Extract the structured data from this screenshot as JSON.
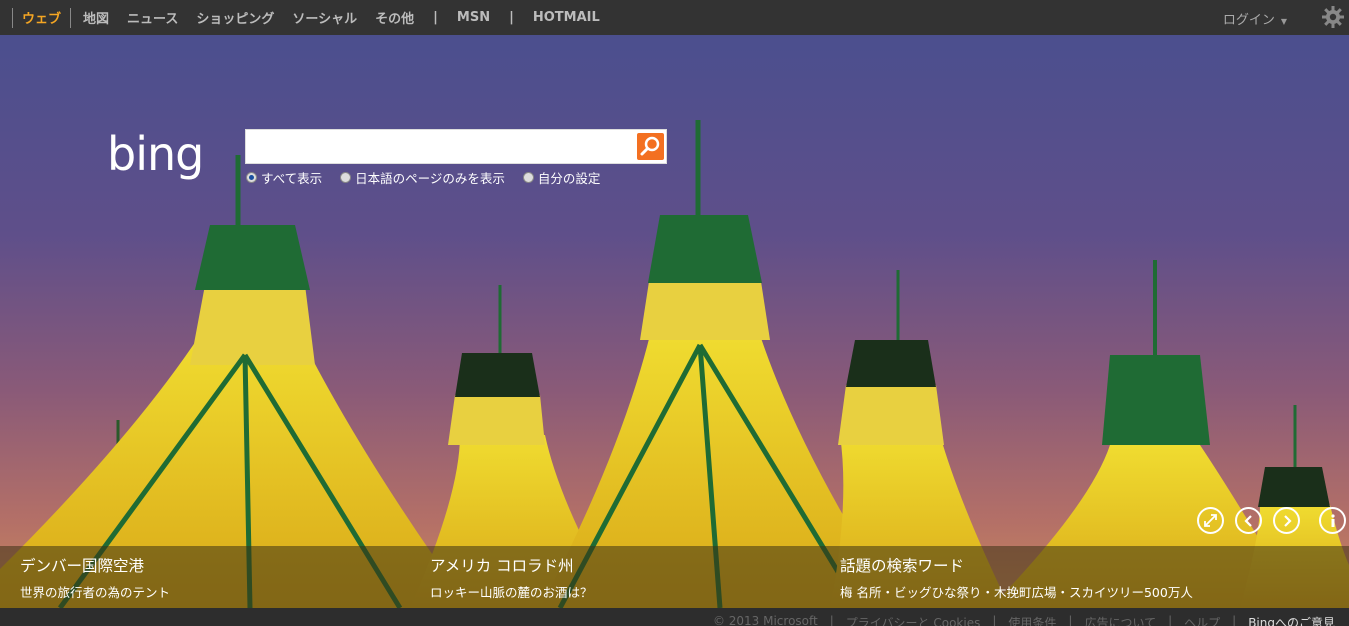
{
  "nav": {
    "items": [
      "ウェブ",
      "地図",
      "ニュース",
      "ショッピング",
      "ソーシャル",
      "その他"
    ],
    "pipe": "|",
    "extra": [
      "MSN",
      "HOTMAIL"
    ],
    "login": "ログイン"
  },
  "search": {
    "logo": "bing",
    "value": "",
    "options": [
      "すべて表示",
      "日本語のページのみを表示",
      "自分の設定"
    ],
    "selected_option": 0
  },
  "captions": [
    {
      "title": "デンバー国際空港",
      "sub": "世界の旅行者の為のテント"
    },
    {
      "title": "アメリカ コロラド州",
      "sub": "ロッキー山脈の麓のお酒は？"
    },
    {
      "title": "話題の検索ワード",
      "sub": "梅 名所・ビッグひな祭り・木挽町広場・スカイツリー500万人"
    }
  ],
  "controls": {
    "expand": "expand-icon",
    "prev": "chevron-left-icon",
    "next": "chevron-right-icon",
    "info": "info-icon"
  },
  "footer": {
    "links": [
      "© 2013 Microsoft",
      "|",
      "プライバシーと Cookies",
      "|",
      "使用条件",
      "|",
      "広告について",
      "|",
      "ヘルプ",
      "|",
      "Bingへのご意見"
    ]
  },
  "colors": {
    "accent": "#f5a623",
    "search_button": "#f37021"
  }
}
